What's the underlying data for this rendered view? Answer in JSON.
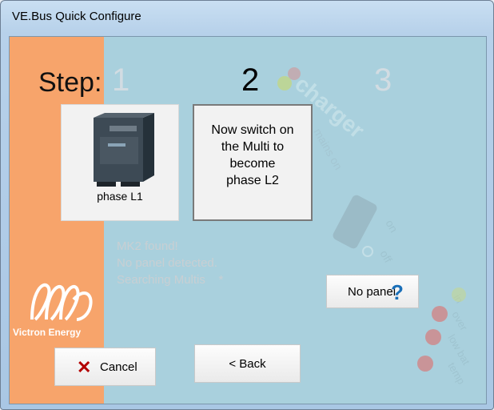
{
  "window": {
    "title": "VE.Bus Quick Configure"
  },
  "steps": {
    "label": "Step:",
    "items": [
      "1",
      "2",
      "3"
    ],
    "active": "2"
  },
  "card_phase1": {
    "caption": "phase L1"
  },
  "card_instruction": {
    "text_lines": [
      "Now switch on",
      "the Multi to",
      "become",
      "phase L2"
    ]
  },
  "status": {
    "lines": [
      "MK2 found!",
      "No panel detected.",
      "Searching Multis    *"
    ]
  },
  "buttons": {
    "no_panel": "No panel",
    "cancel": "Cancel",
    "back": "< Back"
  },
  "brand": {
    "name": "Victron Energy"
  },
  "background_labels": [
    "charger",
    "mains on",
    "on",
    "off",
    "on",
    "in",
    "over",
    "low bat",
    "temp"
  ],
  "colors": {
    "sidebar": "#f7a46b",
    "client_bg": "#a9d0dd",
    "question_icon": "#1a6fb8",
    "cancel_icon": "#b30000"
  }
}
